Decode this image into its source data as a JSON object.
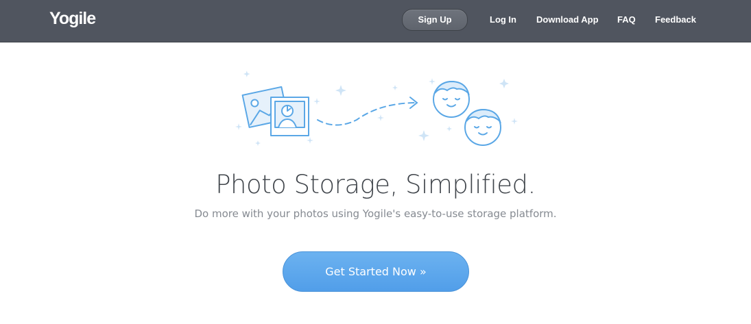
{
  "nav": {
    "logo": "Yogile",
    "signup": "Sign Up",
    "login": "Log In",
    "download": "Download App",
    "faq": "FAQ",
    "feedback": "Feedback",
    "bar_color": "#50555f"
  },
  "hero": {
    "illustration_icons": [
      "photos-icon",
      "dashed-arrow-icon",
      "smiling-face-icon",
      "smiling-face-icon",
      "sparkle-icon"
    ],
    "illustration_color": "#5aa7e6",
    "headline": "Photo Storage, Simplified.",
    "subheadline": "Do more with your photos using Yogile's easy-to-use storage platform.",
    "cta": "Get Started Now »",
    "cta_color": "#5aa6ec"
  }
}
